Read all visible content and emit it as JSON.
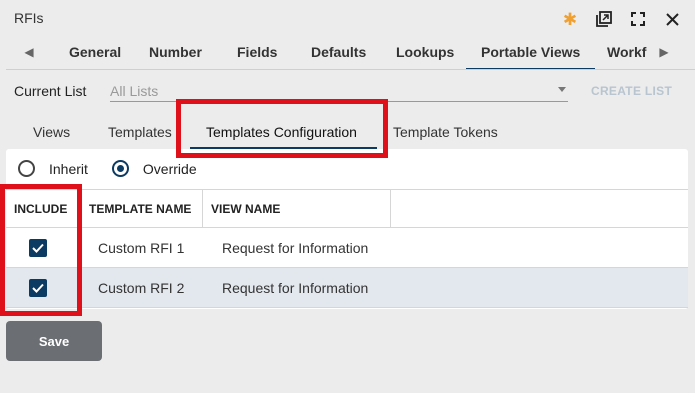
{
  "window": {
    "title": "RFIs",
    "icons": [
      "modified-star-icon",
      "popout-icon",
      "maximize-icon",
      "close-icon"
    ]
  },
  "tabs": {
    "items": [
      "General",
      "Number",
      "Fields",
      "Defaults",
      "Lookups",
      "Portable Views",
      "Workf"
    ],
    "active": "Portable Views"
  },
  "current_list": {
    "label": "Current List",
    "value": "All Lists",
    "create_label": "CREATE LIST"
  },
  "subtabs": {
    "items": [
      "Views",
      "Templates",
      "Templates Configuration",
      "Template Tokens"
    ],
    "active": "Templates Configuration"
  },
  "mode": {
    "options": [
      "Inherit",
      "Override"
    ],
    "selected": "Override"
  },
  "grid": {
    "columns": [
      "INCLUDE",
      "TEMPLATE NAME",
      "VIEW NAME"
    ],
    "rows": [
      {
        "include": true,
        "template_name": "Custom RFI 1",
        "view_name": "Request for Information"
      },
      {
        "include": true,
        "template_name": "Custom RFI 2",
        "view_name": "Request for Information"
      }
    ]
  },
  "actions": {
    "save_label": "Save"
  },
  "colors": {
    "accent": "#0b3a62",
    "highlight": "#e0101a",
    "star": "#f0a030"
  }
}
